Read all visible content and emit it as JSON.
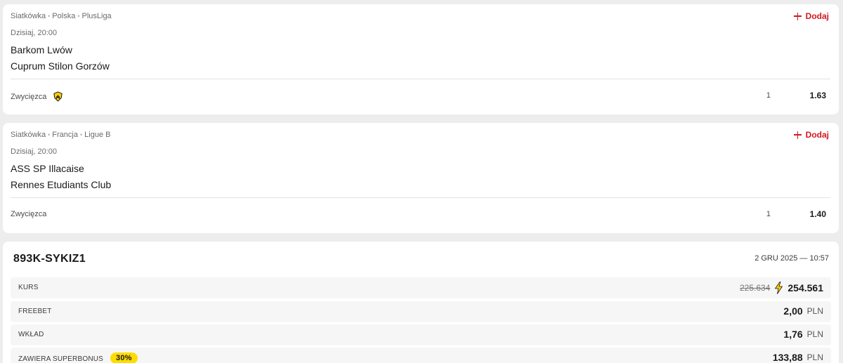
{
  "matches": [
    {
      "breadcrumb": [
        "Siatkówka",
        "Polska",
        "PlusLiga"
      ],
      "add_label": "Dodaj",
      "time": "Dzisiaj, 20:00",
      "home": "Barkom Lwów",
      "away": "Cuprum Stilon Gorzów",
      "market": "Zwycięzca",
      "market_icon": "boost-shield-icon",
      "selection": "1",
      "odds": "1.63"
    },
    {
      "breadcrumb": [
        "Siatkówka",
        "Francja",
        "Ligue B"
      ],
      "add_label": "Dodaj",
      "time": "Dzisiaj, 20:00",
      "home": "ASS SP Illacaise",
      "away": "Rennes Etudiants Club",
      "market": "Zwycięzca",
      "selection": "1",
      "odds": "1.40"
    }
  ],
  "ticket": {
    "id": "893K-SYKIZ1",
    "date": "2 GRU 2025 — 10:57",
    "kurs": {
      "label": "KURS",
      "old_value": "225.634",
      "value": "254.561",
      "icon": "lightning-bolt-icon"
    },
    "freebet": {
      "label": "FREEBET",
      "value": "2,00",
      "currency": "PLN"
    },
    "wklad": {
      "label": "WKŁAD",
      "value": "1,76",
      "currency": "PLN"
    },
    "superbonus": {
      "label": "ZAWIERA SUPERBONUS",
      "badge": "30%",
      "value": "133,88",
      "currency": "PLN"
    }
  },
  "colors": {
    "accent_red": "#d3171f",
    "badge_yellow": "#ffdc00",
    "background": "#ededed"
  }
}
